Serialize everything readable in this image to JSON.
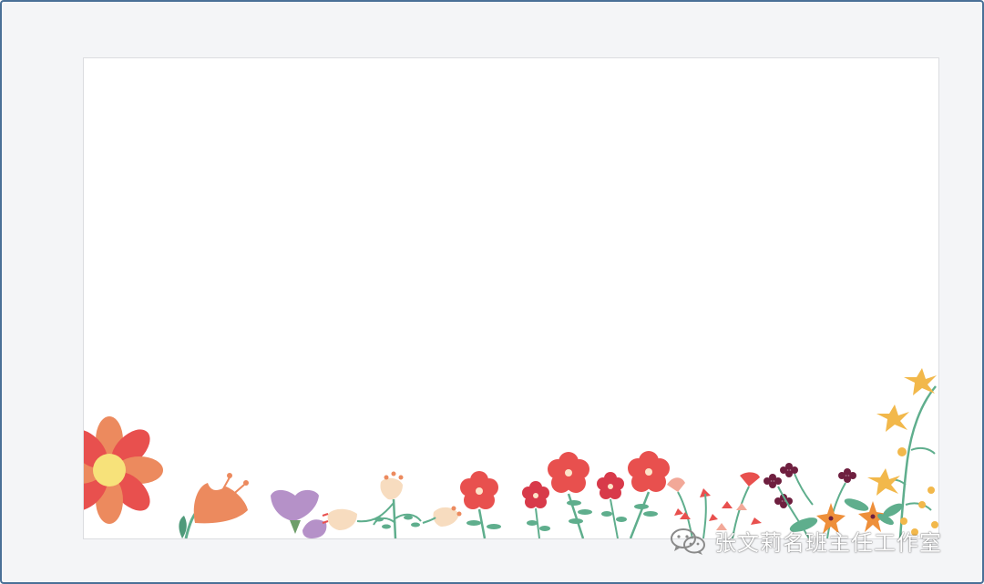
{
  "watermark": {
    "icon": "wechat-icon",
    "text": "张文莉名班主任工作室"
  },
  "colors": {
    "frame_border": "#4a7097",
    "frame_background": "#f4f5f7",
    "slide_background": "#ffffff",
    "petal_red": "#e8504e",
    "petal_orange": "#ec8a5e",
    "petal_purple": "#b591c8",
    "petal_yellow": "#f2b84b",
    "petal_cream": "#f7dcbf",
    "berry_plum": "#6e1f3f",
    "leaf_green": "#5fae8d"
  }
}
